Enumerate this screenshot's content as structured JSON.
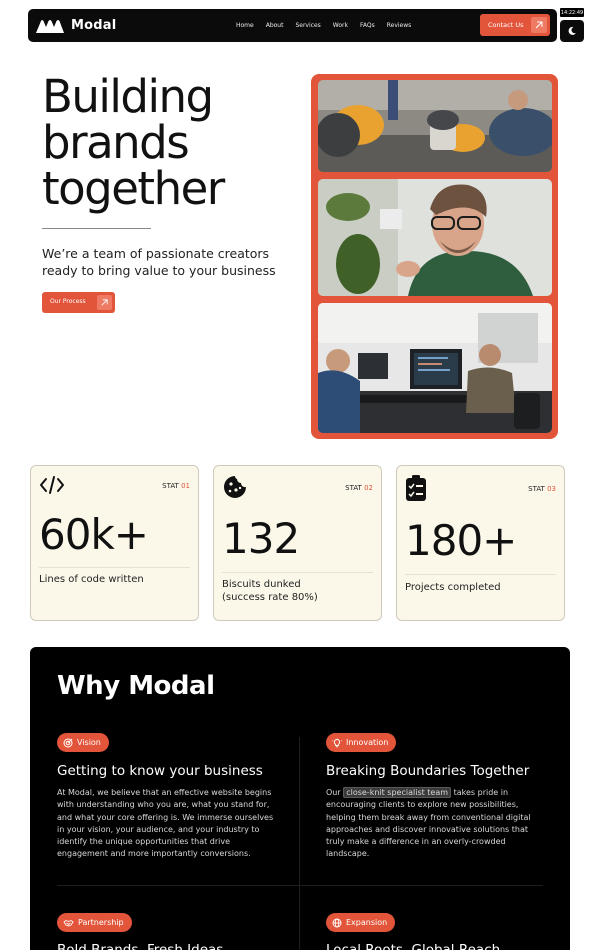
{
  "nav": {
    "brand": "Modal",
    "links": [
      "Home",
      "About",
      "Services",
      "Work",
      "FAQs",
      "Reviews"
    ],
    "contact_label": "Contact Us",
    "clock": "14:22:49",
    "theme_icon": "moon-icon"
  },
  "hero": {
    "title_lines": [
      "Building",
      "brands",
      "together"
    ],
    "subtitle": "We’re a team of passionate creators ready to bring value to your business",
    "process_label": "Our Process"
  },
  "stats": [
    {
      "icon": "code-icon",
      "label": "STAT",
      "num": "01",
      "value": "60k+",
      "desc": "Lines of code written"
    },
    {
      "icon": "cookie-icon",
      "label": "STAT",
      "num": "02",
      "value": "132",
      "desc": "Biscuits dunked (success rate 80%)"
    },
    {
      "icon": "clipboard-check-icon",
      "label": "STAT",
      "num": "03",
      "value": "180+",
      "desc": "Projects completed"
    }
  ],
  "why": {
    "title": "Why Modal",
    "features": [
      {
        "tag": "Vision",
        "title": "Getting to know your business",
        "body": "At Modal, we believe that an effective website begins with understanding who you are, what you stand for, and what your core offering is. We immerse ourselves in your vision, your audience, and your industry to identify the unique opportunities that drive engagement and more importantly conversions."
      },
      {
        "tag": "Innovation",
        "title": "Breaking Boundaries Together",
        "body_pre": "Our",
        "body_highlight": "close-knit specialist team",
        "body_post": "takes pride in encouraging clients to explore new possibilities, helping them break away from conventional digital approaches and discover innovative solutions that truly make a difference in an overly-crowded landscape."
      },
      {
        "tag": "Partnership",
        "title": "Bold Brands, Fresh Ideas"
      },
      {
        "tag": "Expansion",
        "title": "Local Roots, Global Reach"
      }
    ]
  },
  "colors": {
    "accent": "#e2553a",
    "card_bg": "#fbf8ea",
    "dark": "#000000"
  }
}
